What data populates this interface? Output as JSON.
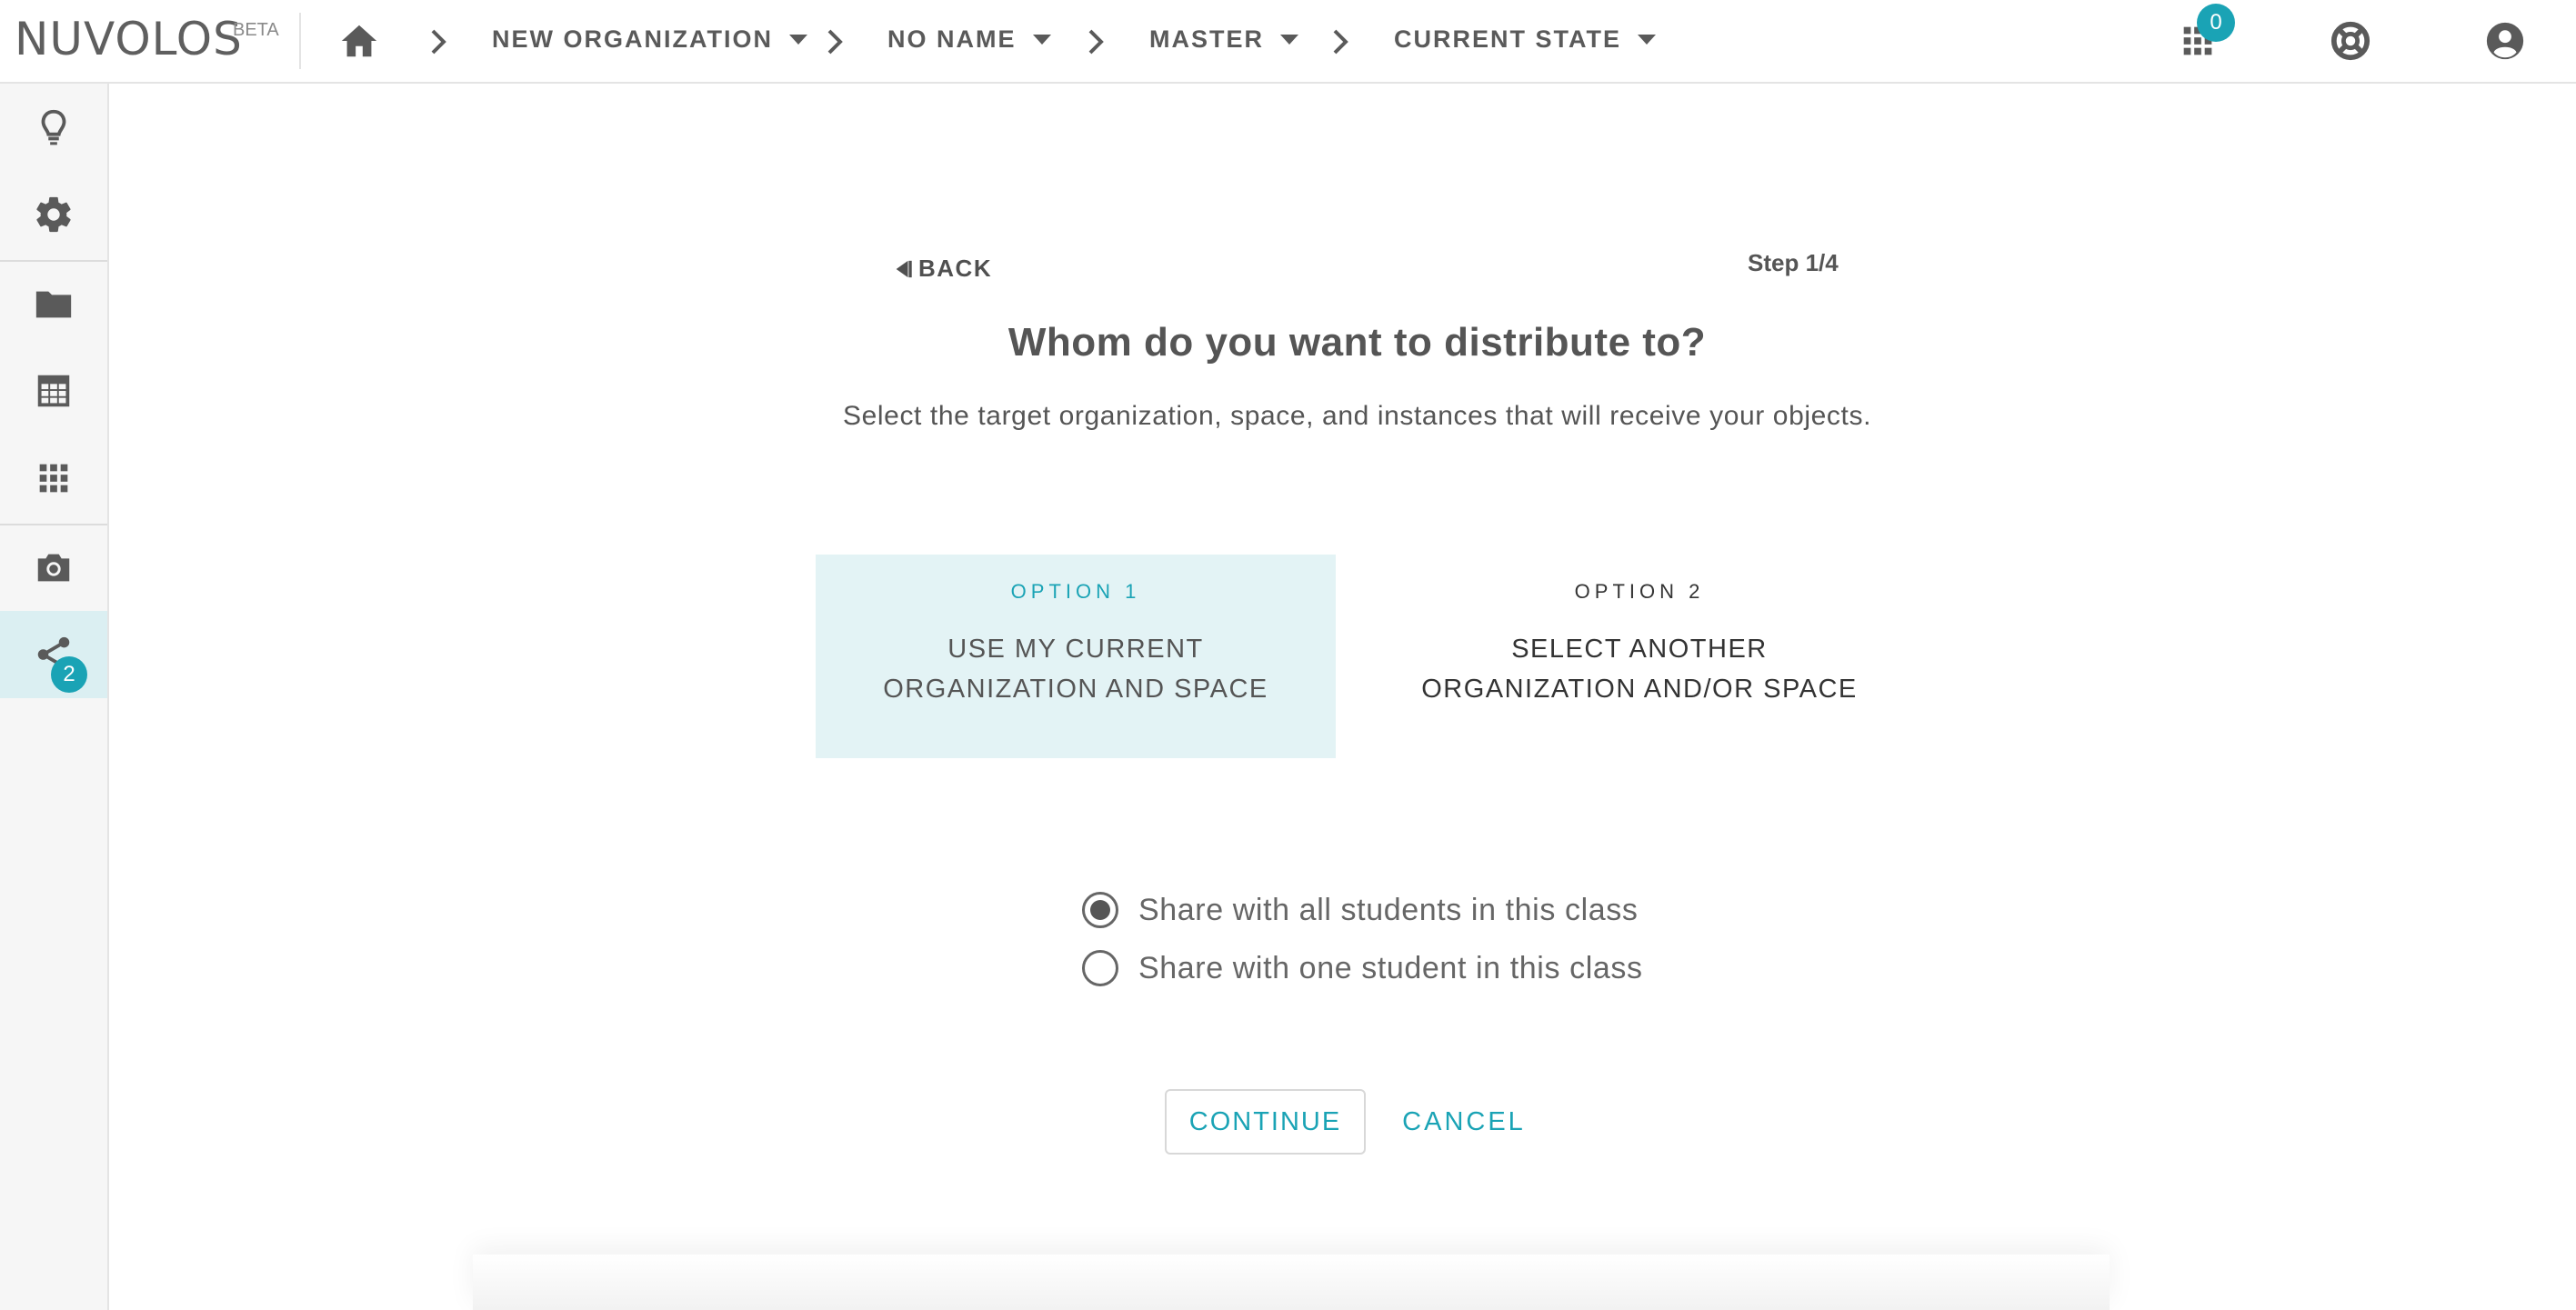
{
  "app": {
    "logo": "NUVOLOS",
    "logo_badge": "BETA"
  },
  "breadcrumb": [
    {
      "label": "NEW ORGANIZATION"
    },
    {
      "label": "NO NAME"
    },
    {
      "label": "MASTER"
    },
    {
      "label": "CURRENT STATE"
    }
  ],
  "topbar": {
    "apps_count": "0"
  },
  "sidebar": {
    "items": [
      {
        "icon": "lightbulb-icon"
      },
      {
        "icon": "gear-icon"
      },
      {
        "icon": "folder-icon"
      },
      {
        "icon": "table-icon"
      },
      {
        "icon": "apps-grid-icon"
      },
      {
        "icon": "camera-icon"
      },
      {
        "icon": "share-icon",
        "badge": "2",
        "active": true
      }
    ]
  },
  "wizard": {
    "back_label": "BACK",
    "step": "Step 1/4",
    "title": "Whom do you want to distribute to?",
    "subtitle": "Select the target organization, space, and instances that will receive your objects.",
    "options": [
      {
        "label": "OPTION 1",
        "text": "USE MY CURRENT ORGANIZATION AND SPACE",
        "selected": true
      },
      {
        "label": "OPTION 2",
        "text": "SELECT ANOTHER ORGANIZATION AND/OR SPACE",
        "selected": false
      }
    ],
    "radios": [
      {
        "label": "Share with all students in this class",
        "checked": true
      },
      {
        "label": "Share with one student in this class",
        "checked": false
      }
    ],
    "continue_label": "CONTINUE",
    "cancel_label": "CANCEL"
  },
  "colors": {
    "accent": "#1aa3b5",
    "selected_bg": "#e3f3f5"
  }
}
